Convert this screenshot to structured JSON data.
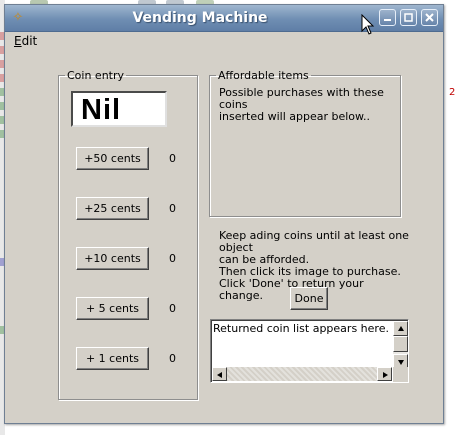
{
  "window": {
    "title": "Vending Machine"
  },
  "menu": {
    "edit": {
      "accel": "E",
      "rest": "dit"
    }
  },
  "coin_entry": {
    "legend": "Coin entry",
    "display": "Nil",
    "buttons": [
      {
        "label": "+50 cents",
        "count": "0"
      },
      {
        "label": "+25 cents",
        "count": "0"
      },
      {
        "label": "+10 cents",
        "count": "0"
      },
      {
        "label": "+ 5 cents",
        "count": "0"
      },
      {
        "label": "+ 1 cents",
        "count": "0"
      }
    ]
  },
  "affordable": {
    "legend": "Affordable items",
    "line1": "Possible purchases with these coins",
    "line2": "inserted will appear below.."
  },
  "instructions": {
    "line1": "Keep ading coins until at least one object",
    "line2": "can be afforded.",
    "line3": "Then click its image to purchase.",
    "line4": "Click 'Done' to return your change."
  },
  "done_label": "Done",
  "returned_text": "Returned coin list appears here.",
  "background": {
    "side_text": "2"
  },
  "colors": {
    "titlebar": "#6f8eb3",
    "window_bg": "#d4d0c8"
  }
}
